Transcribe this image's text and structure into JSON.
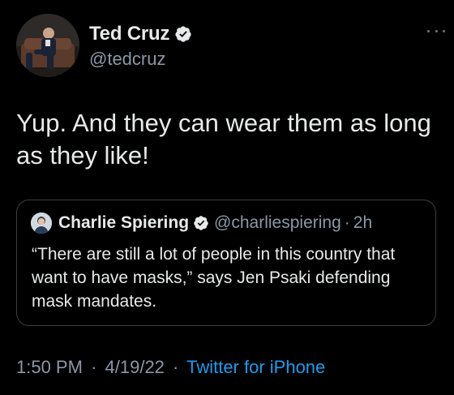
{
  "author": {
    "display_name": "Ted Cruz",
    "handle": "@tedcruz",
    "verified_icon": "verified-badge-icon",
    "avatar_icon": "profile-photo"
  },
  "tweet": {
    "text": "Yup. And they can wear them as long as they like!"
  },
  "quoted_tweet": {
    "display_name": "Charlie Spiering",
    "handle": "@charliespiering",
    "separator": "·",
    "time": "2h",
    "text": "“There are still a lot of people in this country that want to have masks,” says Jen Psaki defending mask mandates."
  },
  "meta": {
    "time": "1:50 PM",
    "sep1": "·",
    "date": "4/19/22",
    "sep2": "·",
    "source": "Twitter for iPhone"
  },
  "colors": {
    "background": "#000000",
    "text_primary": "#e7e9ea",
    "text_secondary": "#8b98a5",
    "accent": "#1d9bf0",
    "border": "#3a3f44"
  }
}
